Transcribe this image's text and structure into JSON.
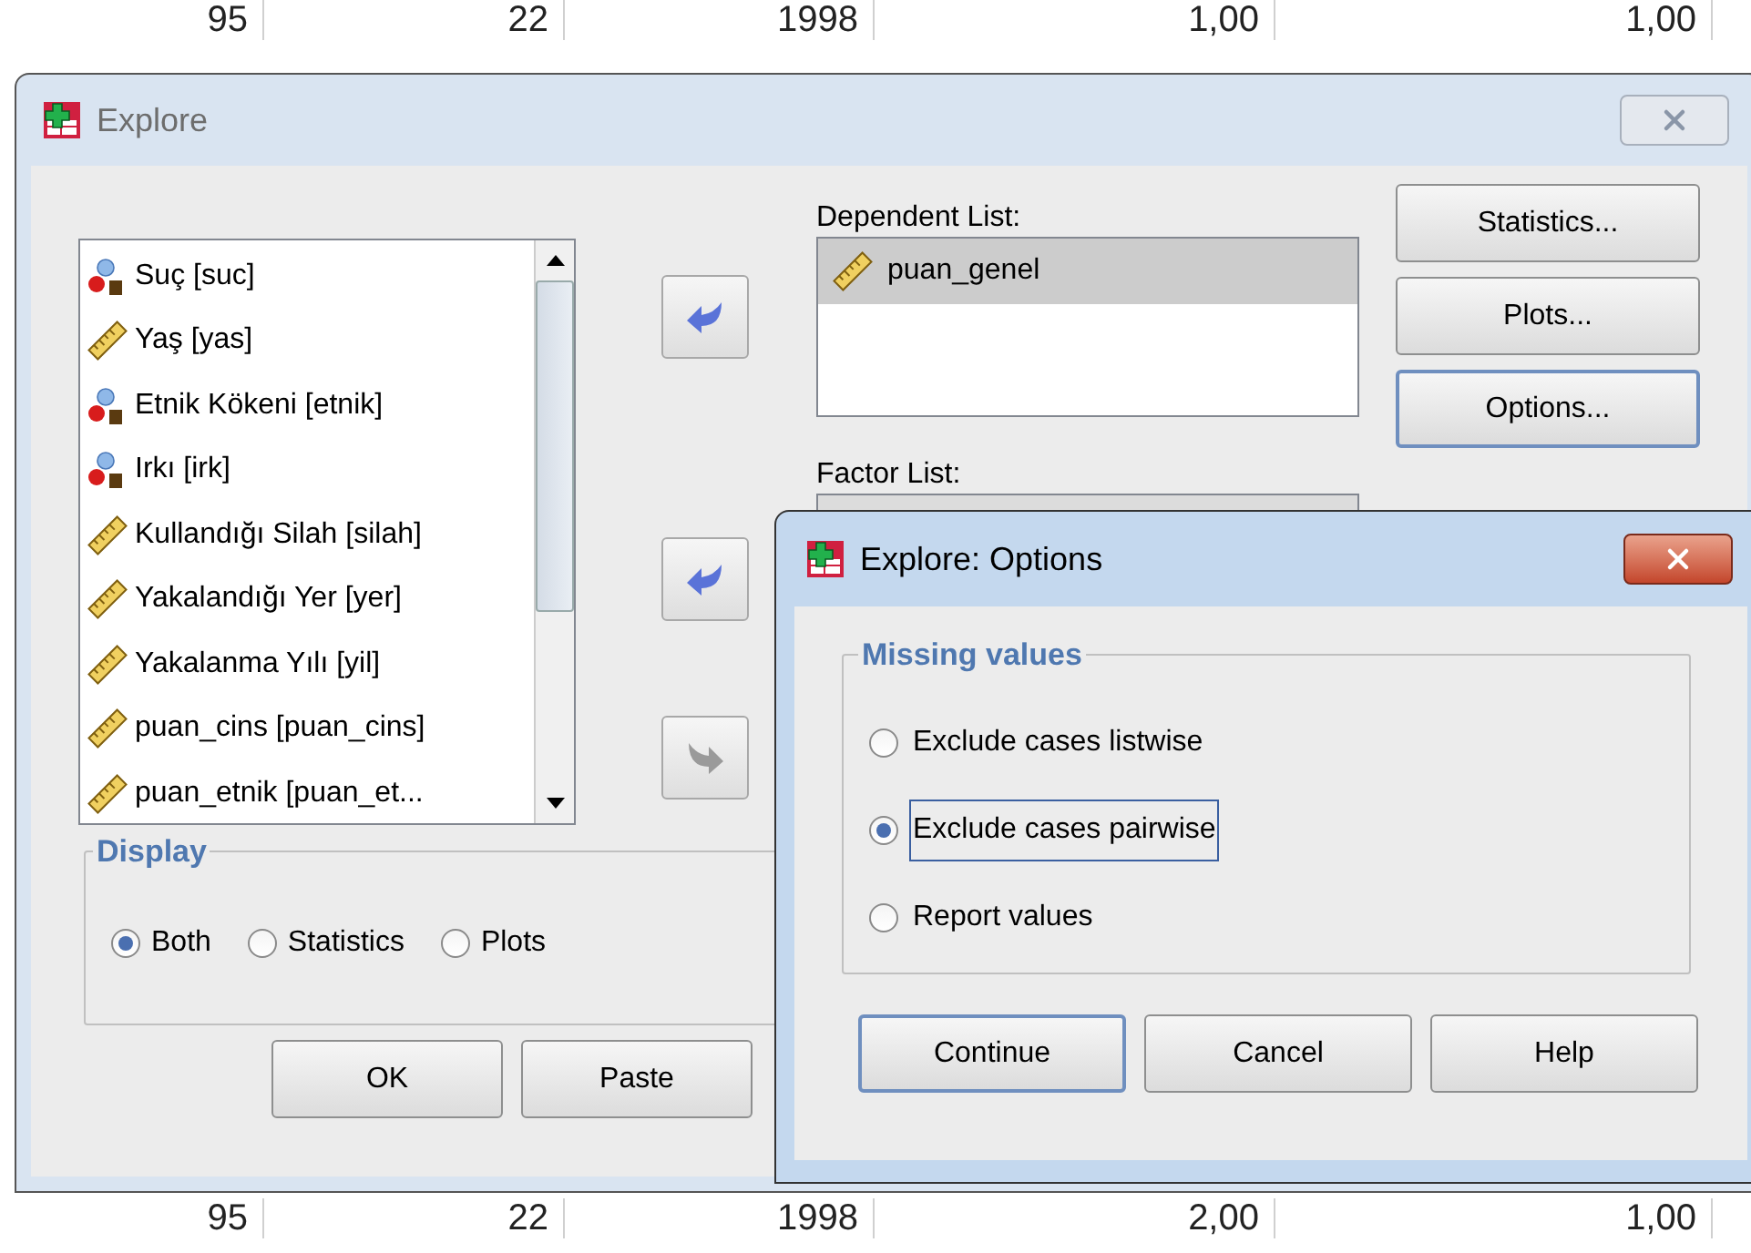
{
  "sheet_rows": [
    {
      "cells": [
        "95",
        "22",
        "1998",
        "1,00",
        "1,00"
      ]
    },
    {
      "cells": [
        "95",
        "22",
        "1998",
        "2,00",
        "1,00"
      ]
    }
  ],
  "explore": {
    "title": "Explore",
    "active": false,
    "variables": [
      {
        "kind": "nominal",
        "label": "Suç [suc]"
      },
      {
        "kind": "scale",
        "label": "Yaş [yas]"
      },
      {
        "kind": "nominal",
        "label": "Etnik Kökeni [etnik]"
      },
      {
        "kind": "nominal",
        "label": "Irkı [irk]"
      },
      {
        "kind": "scale",
        "label": "Kullandığı Silah [silah]"
      },
      {
        "kind": "scale",
        "label": "Yakalandığı Yer [yer]"
      },
      {
        "kind": "scale",
        "label": "Yakalanma Yılı [yil]"
      },
      {
        "kind": "scale",
        "label": "puan_cins [puan_cins]"
      },
      {
        "kind": "scale",
        "label": "puan_etnik [puan_et..."
      }
    ],
    "arrow_buttons": [
      {
        "kind": "left",
        "disabled": false
      },
      {
        "kind": "left",
        "disabled": false
      },
      {
        "kind": "right",
        "disabled": true
      }
    ],
    "dependent_list": {
      "label": "Dependent List:",
      "items": [
        {
          "kind": "scale",
          "label": "puan_genel",
          "selected": true
        }
      ]
    },
    "factor_list": {
      "label": "Factor List:"
    },
    "side_buttons": [
      {
        "label": "Statistics...",
        "default": false
      },
      {
        "label": "Plots...",
        "default": false
      },
      {
        "label": "Options...",
        "default": true
      }
    ],
    "display": {
      "title": "Display",
      "options": [
        {
          "label": "Both",
          "selected": true
        },
        {
          "label": "Statistics",
          "selected": false
        },
        {
          "label": "Plots",
          "selected": false
        }
      ]
    },
    "buttons": [
      {
        "label": "OK"
      },
      {
        "label": "Paste"
      }
    ]
  },
  "options_dialog": {
    "title": "Explore: Options",
    "active": true,
    "group": {
      "title": "Missing values",
      "options": [
        {
          "label": "Exclude cases listwise",
          "selected": false,
          "focused": false
        },
        {
          "label": "Exclude cases pairwise",
          "selected": true,
          "focused": true
        },
        {
          "label": "Report values",
          "selected": false,
          "focused": false
        }
      ]
    },
    "buttons": [
      {
        "label": "Continue",
        "default": true
      },
      {
        "label": "Cancel",
        "default": false
      },
      {
        "label": "Help",
        "default": false
      }
    ]
  }
}
